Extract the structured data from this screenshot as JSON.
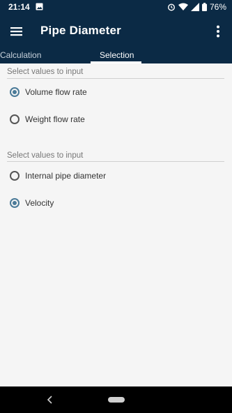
{
  "status_bar": {
    "time": "21:14",
    "battery": "76%",
    "icons": [
      "image-icon",
      "alarm-icon",
      "wifi-icon",
      "signal-icon",
      "battery-icon"
    ]
  },
  "app_bar": {
    "title": "Pipe Diameter",
    "icons": [
      "menu-icon",
      "overflow-icon"
    ]
  },
  "tabs": [
    {
      "label": "Calculation",
      "active": false
    },
    {
      "label": "Selection",
      "active": true
    }
  ],
  "groups": [
    {
      "title": "Select values to input",
      "options": [
        {
          "label": "Volume flow rate",
          "checked": true
        },
        {
          "label": "Weight flow rate",
          "checked": false
        }
      ]
    },
    {
      "title": "Select values to input",
      "options": [
        {
          "label": "Internal pipe diameter",
          "checked": false
        },
        {
          "label": "Velocity",
          "checked": true
        }
      ]
    }
  ],
  "colors": {
    "app_bar": "#0b2a45",
    "accent": "#4a7a98",
    "background": "#f5f5f5"
  }
}
